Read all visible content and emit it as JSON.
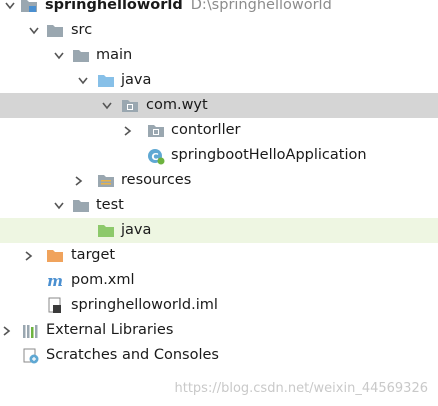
{
  "tree": {
    "root": {
      "name": "springhelloworld",
      "path": "D:\\springhelloworld",
      "icon": "module-folder-icon",
      "expanded": true
    },
    "src": {
      "label": "src",
      "icon": "folder-icon",
      "expanded": true
    },
    "main": {
      "label": "main",
      "icon": "folder-icon",
      "expanded": true
    },
    "main_java": {
      "label": "java",
      "icon": "source-root-folder-icon",
      "expanded": true
    },
    "package": {
      "label": "com.wyt",
      "icon": "package-icon",
      "expanded": true,
      "selected": true
    },
    "controller": {
      "label": "contorller",
      "icon": "package-icon",
      "expanded": false
    },
    "app_class": {
      "label": "springbootHelloApplication",
      "icon": "spring-boot-class-icon"
    },
    "resources": {
      "label": "resources",
      "icon": "resources-folder-icon",
      "expanded": false
    },
    "test": {
      "label": "test",
      "icon": "folder-icon",
      "expanded": true
    },
    "test_java": {
      "label": "java",
      "icon": "test-source-root-folder-icon"
    },
    "target": {
      "label": "target",
      "icon": "excluded-folder-icon",
      "expanded": false
    },
    "pom": {
      "label": "pom.xml",
      "icon": "maven-icon"
    },
    "iml": {
      "label": "springhelloworld.iml",
      "icon": "iml-file-icon"
    },
    "external_libs": {
      "label": "External Libraries",
      "icon": "libraries-icon",
      "expanded": false
    },
    "scratches": {
      "label": "Scratches and Consoles",
      "icon": "scratches-icon"
    }
  },
  "watermark": "https://blog.csdn.net/weixin_44569326",
  "colors": {
    "selection": "#d5d5d5",
    "test_root_bg": "#eef6e2",
    "folder": "#9aa7b0",
    "source_root": "#87c0e8",
    "test_root": "#8dc96b",
    "excluded": "#f0a35c",
    "path_text": "#8c8c8c"
  }
}
